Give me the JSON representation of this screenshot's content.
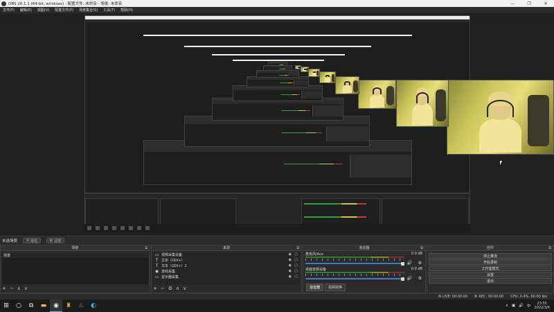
{
  "window": {
    "title": "OBS 26.1.1 (64-bit, windows) - 配置文件: 未命名 - 场景: 未命名",
    "minimize": "—",
    "maximize": "❐",
    "close": "✕"
  },
  "menu": [
    "文件(F)",
    "编辑(E)",
    "视图(V)",
    "配置文件(P)",
    "场景集合(S)",
    "工具(T)",
    "帮助(H)"
  ],
  "scene_status": {
    "label": "未选场景",
    "props_button": "属性",
    "filters_button": "滤镜"
  },
  "docks": {
    "scenes": {
      "title": "场景",
      "items": [
        "场景"
      ],
      "footer": [
        "+",
        "−",
        "∧",
        "∨"
      ]
    },
    "sources": {
      "title": "来源",
      "items": [
        {
          "icon": "camera-icon",
          "glyph": "▭",
          "label": "视频采集设备"
        },
        {
          "icon": "text-icon",
          "glyph": "T",
          "label": "文本（GDI+）"
        },
        {
          "icon": "text-icon",
          "glyph": "T",
          "label": "文本（GDI+）2"
        },
        {
          "icon": "game-capture-icon",
          "glyph": "◉",
          "label": "游戏采集"
        },
        {
          "icon": "display-capture-icon",
          "glyph": "▭",
          "label": "显示器采集"
        }
      ],
      "footer": [
        "+",
        "−",
        "⚙",
        "∧",
        "∨"
      ]
    },
    "mixer": {
      "title": "混音器",
      "tracks": [
        {
          "name": "麦克风/Aux",
          "db": "0.0 dB"
        },
        {
          "name": "桌面音频设备",
          "db": "0.0 dB"
        }
      ],
      "tabs": [
        "混音器",
        "视频转换"
      ]
    },
    "controls": {
      "title": "控件",
      "buttons": [
        "停止推流",
        "开始录制",
        "工作室模式",
        "设置",
        "退出"
      ]
    }
  },
  "statusbar": {
    "live": "LIVE: 00:00:00",
    "rec": "REC: 00:00:00",
    "cpu": "CPU: 0.4%, 60.00 fps"
  },
  "taskbar": {
    "time": "23:55",
    "date": "2022/3/6",
    "icons": [
      {
        "name": "windows-start-icon",
        "glyph": "⊞"
      },
      {
        "name": "search-icon",
        "glyph": "○"
      },
      {
        "name": "task-view-icon",
        "glyph": "⧉"
      },
      {
        "name": "file-explorer-icon",
        "glyph": "▬"
      },
      {
        "name": "obs-icon",
        "glyph": "◉",
        "active": true
      },
      {
        "name": "shield-app-icon",
        "glyph": "♜"
      },
      {
        "name": "steam-icon",
        "glyph": "♨"
      },
      {
        "name": "edge-icon",
        "glyph": "◐"
      }
    ],
    "tray": [
      "∧",
      "▣",
      "🔊",
      "中"
    ]
  },
  "colors": {
    "accent_blue": "#3b7bd4",
    "panel": "#2b2b2b",
    "preview_bg": "#202020"
  }
}
